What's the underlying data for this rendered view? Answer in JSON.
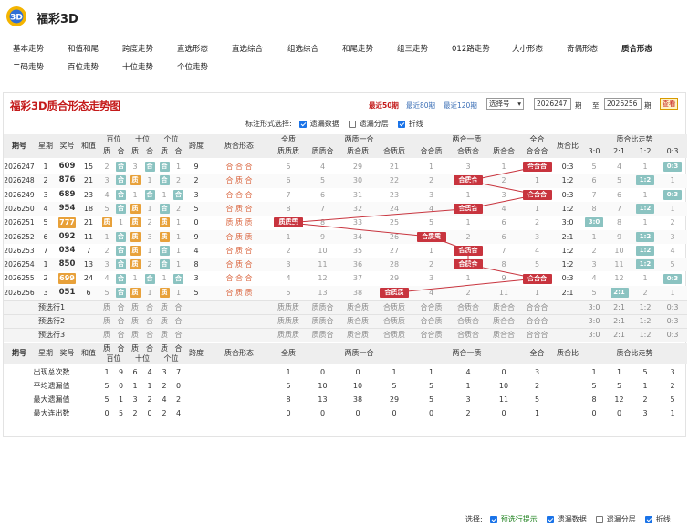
{
  "app": {
    "title": "福彩3D"
  },
  "nav": {
    "row1": [
      "基本走势",
      "和值和尾",
      "跨度走势",
      "直选形态",
      "直选综合",
      "组选综合",
      "和尾走势",
      "组三走势",
      "012路走势",
      "大小形态",
      "奇偶形态",
      "质合形态"
    ],
    "row2": [
      "二码走势",
      "百位走势",
      "十位走势",
      "个位走势"
    ]
  },
  "panel": {
    "title": "福彩3D质合形态走势图",
    "periods": [
      "最近50期",
      "最近80期",
      "最近120期"
    ],
    "select_label": "选择号",
    "range_from": "2026247",
    "range_to": "2026256",
    "qi1": "期",
    "zhi": "至",
    "qi2": "期",
    "query": "查看",
    "options_label": "标注形式选择:",
    "options": [
      "遗漏数据",
      "遗漏分层",
      "折线"
    ],
    "options_on": [
      true,
      false,
      true
    ]
  },
  "headers": {
    "period": "期号",
    "weekday": "星期",
    "award": "奖号",
    "sum": "和值",
    "bai": "百位",
    "shi": "十位",
    "ge": "个位",
    "span": "跨度",
    "shape": "质合形态",
    "quanzhi": "全质",
    "liangzhi": "两质一合",
    "lianghe": "两合一质",
    "quanhe": "全合",
    "ratio": "质合比",
    "ratio_trend": "质合比走势",
    "z": "质",
    "h": "合",
    "sub_quanzhi": "质质质",
    "sub_liangzhi": [
      "质质合",
      "质合质",
      "合质质"
    ],
    "sub_lianghe": [
      "合合质",
      "合质合",
      "质合合"
    ],
    "sub_quanhe": "合合合",
    "sub_ratio": [
      "3:0",
      "2:1",
      "1:2",
      "0:3"
    ]
  },
  "rows": [
    {
      "period": "2026247",
      "week": "1",
      "award": "609",
      "sum": "15",
      "bai": [
        "2",
        "合"
      ],
      "shi": [
        "3",
        "合"
      ],
      "ge": [
        "合",
        "1"
      ],
      "span": "9",
      "shape": "合 合 合",
      "qz": "5",
      "lz": [
        "4",
        "29",
        "21"
      ],
      "lh": [
        "1",
        "3",
        "1"
      ],
      "qh": "合合合",
      "ratio": "0:3",
      "trend": [
        "5",
        "4",
        "1",
        "0:3"
      ]
    },
    {
      "period": "2026248",
      "week": "2",
      "award": "876",
      "sum": "21",
      "bai": [
        "3",
        "合"
      ],
      "shi": [
        "质",
        "1"
      ],
      "ge": [
        "合",
        "2"
      ],
      "span": "2",
      "shape": "合 质 合",
      "qz": "6",
      "lz": [
        "5",
        "30",
        "22"
      ],
      "lh": [
        "2",
        "合质合",
        "2"
      ],
      "qh": "1",
      "ratio": "1:2",
      "trend": [
        "6",
        "5",
        "1:2",
        "1"
      ]
    },
    {
      "period": "2026249",
      "week": "3",
      "award": "689",
      "sum": "23",
      "bai": [
        "4",
        "合"
      ],
      "shi": [
        "1",
        "合"
      ],
      "ge": [
        "1",
        "合"
      ],
      "span": "3",
      "shape": "合 合 合",
      "qz": "7",
      "lz": [
        "6",
        "31",
        "23"
      ],
      "lh": [
        "3",
        "1",
        "3"
      ],
      "qh": "合合合",
      "ratio": "0:3",
      "trend": [
        "7",
        "6",
        "1",
        "0:3"
      ]
    },
    {
      "period": "2026250",
      "week": "4",
      "award": "954",
      "sum": "18",
      "bai": [
        "5",
        "合"
      ],
      "shi": [
        "质",
        "1"
      ],
      "ge": [
        "合",
        "2"
      ],
      "span": "5",
      "shape": "合 质 合",
      "qz": "8",
      "lz": [
        "7",
        "32",
        "24"
      ],
      "lh": [
        "4",
        "合质合",
        "4"
      ],
      "qh": "1",
      "ratio": "1:2",
      "trend": [
        "8",
        "7",
        "1:2",
        "1"
      ]
    },
    {
      "period": "2026251",
      "week": "5",
      "award": "777",
      "sum": "21",
      "bai": [
        "质",
        "1"
      ],
      "shi": [
        "质",
        "2"
      ],
      "ge": [
        "质",
        "1"
      ],
      "span": "0",
      "shape": "质 质 质",
      "qz": "质质质",
      "lz": [
        "8",
        "33",
        "25"
      ],
      "lh": [
        "5",
        "1",
        "6"
      ],
      "qh": "2",
      "ratio": "3:0",
      "trend": [
        "3:0",
        "8",
        "1",
        "2"
      ]
    },
    {
      "period": "2026252",
      "week": "6",
      "award": "092",
      "sum": "11",
      "bai": [
        "1",
        "合"
      ],
      "shi": [
        "质",
        "3"
      ],
      "ge": [
        "质",
        "1"
      ],
      "span": "9",
      "shape": "合 质 质",
      "qz": "1",
      "lz": [
        "9",
        "34",
        "26"
      ],
      "lh": [
        "合质质",
        "2",
        "6"
      ],
      "qh": "3",
      "ratio": "2:1",
      "trend": [
        "1",
        "9",
        "1:2",
        "3"
      ]
    },
    {
      "period": "2026253",
      "week": "7",
      "award": "034",
      "sum": "7",
      "bai": [
        "2",
        "合"
      ],
      "shi": [
        "质",
        "1"
      ],
      "ge": [
        "合",
        "1"
      ],
      "span": "4",
      "shape": "合 质 合",
      "qz": "2",
      "lz": [
        "10",
        "35",
        "27"
      ],
      "lh": [
        "1",
        "合质合",
        "7"
      ],
      "qh": "4",
      "ratio": "1:2",
      "trend": [
        "2",
        "10",
        "1:2",
        "4"
      ]
    },
    {
      "period": "2026254",
      "week": "1",
      "award": "850",
      "sum": "13",
      "bai": [
        "3",
        "合"
      ],
      "shi": [
        "质",
        "2"
      ],
      "ge": [
        "合",
        "1"
      ],
      "span": "8",
      "shape": "合 质 合",
      "qz": "3",
      "lz": [
        "11",
        "36",
        "28"
      ],
      "lh": [
        "2",
        "合质合",
        "8"
      ],
      "qh": "5",
      "ratio": "1:2",
      "trend": [
        "3",
        "11",
        "1:2",
        "5"
      ]
    },
    {
      "period": "2026255",
      "week": "2",
      "award": "699",
      "sum": "24",
      "bai": [
        "4",
        "合"
      ],
      "shi": [
        "1",
        "合"
      ],
      "ge": [
        "1",
        "合"
      ],
      "span": "3",
      "shape": "合 合 合",
      "qz": "4",
      "lz": [
        "12",
        "37",
        "29"
      ],
      "lh": [
        "3",
        "1",
        "9"
      ],
      "qh": "合合合",
      "ratio": "0:3",
      "trend": [
        "4",
        "12",
        "1",
        "0:3"
      ]
    },
    {
      "period": "2026256",
      "week": "3",
      "award": "051",
      "sum": "6",
      "bai": [
        "5",
        "合"
      ],
      "shi": [
        "质",
        "1"
      ],
      "ge": [
        "质",
        "1"
      ],
      "span": "5",
      "shape": "合 质 质",
      "qz": "5",
      "lz": [
        "13",
        "38",
        "合质质"
      ],
      "lh": [
        "4",
        "2",
        "11"
      ],
      "qh": "1",
      "ratio": "2:1",
      "trend": [
        "5",
        "2:1",
        "2",
        "1"
      ]
    }
  ],
  "predict_rows": [
    {
      "label": "预选行1",
      "cells": [
        "质",
        "合",
        "质",
        "合",
        "质",
        "合"
      ]
    },
    {
      "label": "预选行2",
      "cells": [
        "质",
        "合",
        "质",
        "合",
        "质",
        "合"
      ]
    },
    {
      "label": "预选行3",
      "cells": [
        "质",
        "合",
        "质",
        "合",
        "质",
        "合"
      ]
    }
  ],
  "predict_ratio": [
    "3:0",
    "2:1",
    "1:2",
    "0:3"
  ],
  "stats": [
    {
      "label": "出现总次数",
      "vals": [
        "1",
        "9",
        "6",
        "4",
        "3",
        "7",
        "",
        "",
        "1",
        "0",
        "0",
        "1",
        "1",
        "4",
        "0",
        "3",
        "",
        "1",
        "1",
        "5",
        "3"
      ]
    },
    {
      "label": "平均遗漏值",
      "vals": [
        "5",
        "0",
        "1",
        "1",
        "2",
        "0",
        "",
        "",
        "5",
        "10",
        "10",
        "5",
        "5",
        "1",
        "10",
        "2",
        "",
        "5",
        "5",
        "1",
        "2"
      ]
    },
    {
      "label": "最大遗漏值",
      "vals": [
        "5",
        "1",
        "3",
        "2",
        "4",
        "2",
        "",
        "",
        "8",
        "13",
        "38",
        "29",
        "5",
        "3",
        "11",
        "5",
        "",
        "8",
        "12",
        "2",
        "5"
      ]
    },
    {
      "label": "最大连出数",
      "vals": [
        "0",
        "5",
        "2",
        "0",
        "2",
        "4",
        "",
        "",
        "0",
        "0",
        "0",
        "0",
        "0",
        "2",
        "0",
        "1",
        "",
        "0",
        "0",
        "3",
        "1"
      ]
    }
  ],
  "footer": {
    "label": "选择:",
    "options": [
      "预选行提示",
      "遗漏数据",
      "遗漏分层",
      "折线"
    ],
    "options_on": [
      true,
      true,
      false,
      true
    ]
  },
  "colors": {
    "accent_red": "#c41a1a",
    "teal": "#8bc3c1",
    "gold": "#e8a13a",
    "hit_red": "#c8343e"
  }
}
